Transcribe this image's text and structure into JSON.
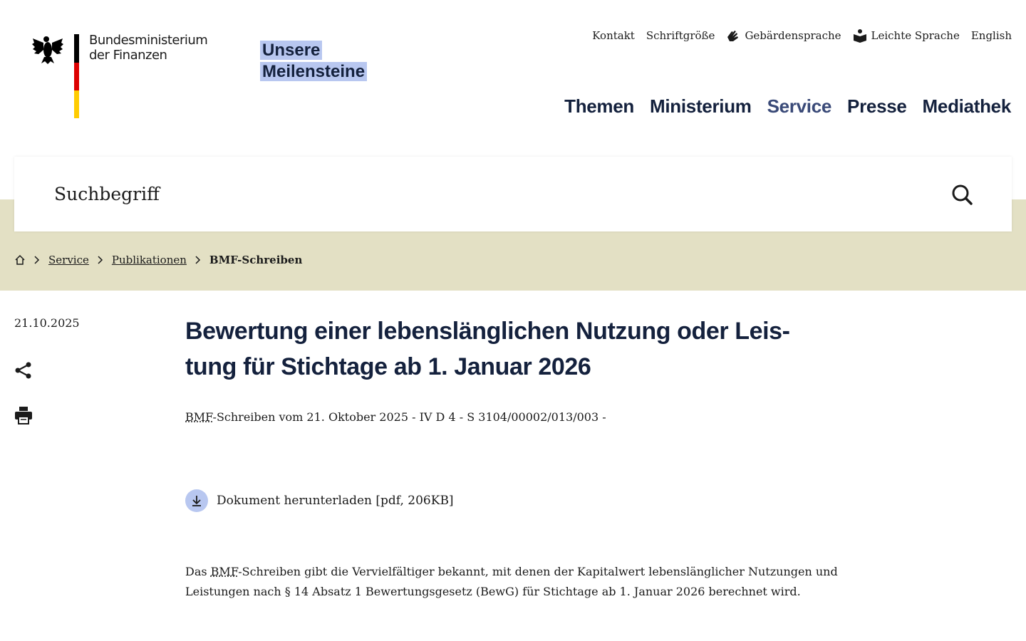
{
  "header": {
    "logo_line1": "Bundesministerium",
    "logo_line2": "der Finanzen",
    "milestones_line1": "Unsere",
    "milestones_line2": "Meilensteine"
  },
  "utility_nav": {
    "contact": "Kontakt",
    "font_size": "Schriftgröße",
    "sign_language": "Gebärdensprache",
    "easy_language": "Leichte Sprache",
    "english": "English"
  },
  "main_nav": {
    "items": [
      "Themen",
      "Ministerium",
      "Service",
      "Presse",
      "Mediathek"
    ],
    "active": "Service"
  },
  "search": {
    "placeholder": "Suchbegriff"
  },
  "breadcrumb": {
    "items": [
      "Service",
      "Publikationen"
    ],
    "current": "BMF-Schreiben"
  },
  "article": {
    "date": "21.10.2025",
    "title_line1": "Bewertung einer lebenslänglichen Nutzung oder Leis-",
    "title_line2": "tung für Stichtage ab 1. Januar 2026",
    "ref_abbr": "BMF",
    "ref_rest": "-Schreiben vom 21. Oktober 2025 - IV D 4 - S 3104/00002/013/003 -",
    "download_label": "Dokument herunterladen [pdf, 206KB]",
    "body_prefix": "Das ",
    "body_abbr": "BMF",
    "body_rest": "-Schreiben gibt die Vervielfältiger bekannt, mit denen der Kapitalwert lebenslänglicher Nutzungen und Leistungen nach § 14 Absatz 1 Bewertungsgesetz (BewG) für Stichtage ab 1. Januar 2026 berechnet wird."
  },
  "colors": {
    "accent": "#b8c7f0",
    "navy": "#14213d",
    "band": "#e3e0c4"
  }
}
